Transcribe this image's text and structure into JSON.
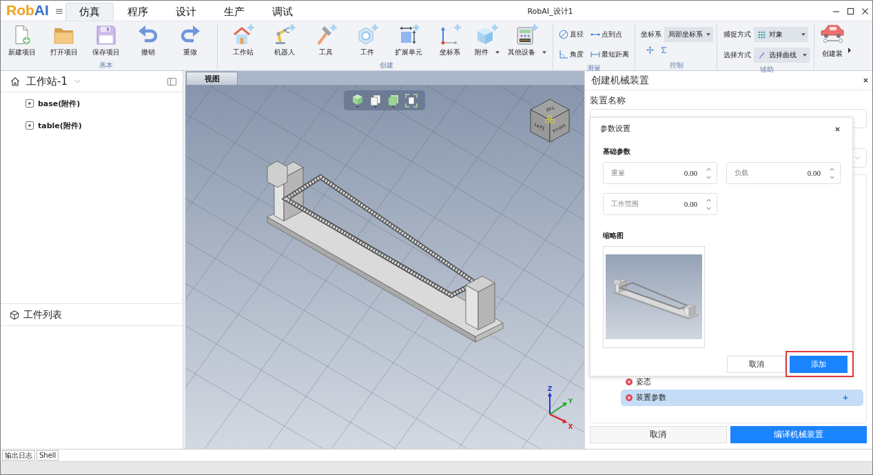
{
  "title_bar": {
    "logo": {
      "first": "Rob",
      "second": "AI"
    },
    "menu_glyph": "≡",
    "tabs": [
      {
        "label": "仿真",
        "selected": true
      },
      {
        "label": "程序",
        "selected": false
      },
      {
        "label": "设计",
        "selected": false
      },
      {
        "label": "生产",
        "selected": false
      },
      {
        "label": "调试",
        "selected": false
      }
    ],
    "title": "RobAI_设计1"
  },
  "ribbon": {
    "groups": [
      {
        "kind": "large",
        "label": "基本",
        "buttons": [
          {
            "label": "新建项目",
            "dropdown": false
          },
          {
            "label": "打开项目",
            "dropdown": false
          },
          {
            "label": "保存项目",
            "dropdown": false
          },
          {
            "label": "撤销",
            "dropdown": false
          },
          {
            "label": "重做",
            "dropdown": false
          }
        ]
      },
      {
        "kind": "large",
        "label": "创建",
        "buttons": [
          {
            "label": "工作站",
            "dropdown": false
          },
          {
            "label": "机器人",
            "dropdown": false
          },
          {
            "label": "工具",
            "dropdown": false
          },
          {
            "label": "工件",
            "dropdown": false
          },
          {
            "label": "扩展单元",
            "dropdown": false
          },
          {
            "label": "坐标系",
            "dropdown": false
          },
          {
            "label": "附件",
            "dropdown": true
          },
          {
            "label": "其他设备",
            "dropdown": true
          }
        ]
      },
      {
        "kind": "measure",
        "label": "测量",
        "tools": [
          "直径",
          "点到点",
          "角度",
          "最短距离"
        ]
      },
      {
        "kind": "control",
        "label": "控制",
        "fields": [
          {
            "label": "坐标系",
            "value": "局部坐标系"
          }
        ]
      },
      {
        "kind": "assist",
        "label": "辅助",
        "fields": [
          {
            "label": "捕捉方式",
            "value": "对象"
          },
          {
            "label": "选择方式",
            "value": "选择曲线"
          }
        ]
      }
    ],
    "overflow_button": "创建装"
  },
  "station_panel": {
    "title": "工作站-1",
    "items": [
      "base(附件)",
      "table(附件)"
    ]
  },
  "parts_panel": {
    "title": "工件列表"
  },
  "viewport": {
    "tab": "视图",
    "view_cube": {
      "top": "Top",
      "left": "Left",
      "front": "Front"
    },
    "axes": {
      "z": "Z",
      "y": "Y",
      "x": "X"
    }
  },
  "mechanism_panel": {
    "title": "创建机械装置",
    "name_label": "装置名称",
    "tree": [
      {
        "label": "姿态",
        "selected": false
      },
      {
        "label": "装置参数",
        "selected": true
      }
    ],
    "buttons": [
      {
        "label": "取消",
        "primary": false
      },
      {
        "label": "编译机械装置",
        "primary": true
      }
    ]
  },
  "params_dialog": {
    "title": "参数设置",
    "section": "基础参数",
    "fields": [
      {
        "label": "重量",
        "value": "0.00"
      },
      {
        "label": "负载",
        "value": "0.00"
      },
      {
        "label": "工作范围",
        "value": "0.00"
      }
    ],
    "thumbnail_label": "缩略图",
    "buttons": [
      {
        "label": "取消",
        "primary": false,
        "highlighted": false
      },
      {
        "label": "添加",
        "primary": true,
        "highlighted": true
      }
    ]
  },
  "bottom_tabs": [
    "输出日志",
    "Shell"
  ]
}
